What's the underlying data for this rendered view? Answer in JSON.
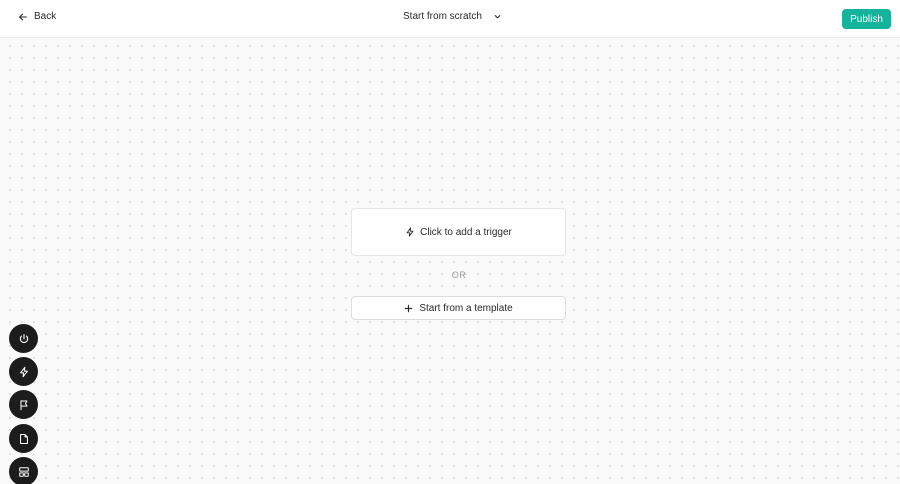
{
  "header": {
    "back_label": "Back",
    "mode_label": "Start from scratch",
    "publish_label": "Publish"
  },
  "canvas": {
    "trigger_label": "Click to add a trigger",
    "or_label": "OR",
    "template_label": "Start from a template"
  },
  "toolbar": {
    "items": [
      {
        "icon": "power-icon"
      },
      {
        "icon": "lightning-icon"
      },
      {
        "icon": "flag-icon"
      },
      {
        "icon": "file-icon"
      },
      {
        "icon": "layout-icon"
      }
    ]
  },
  "colors": {
    "accent": "#14b39b",
    "fab": "#1c1c1c"
  }
}
